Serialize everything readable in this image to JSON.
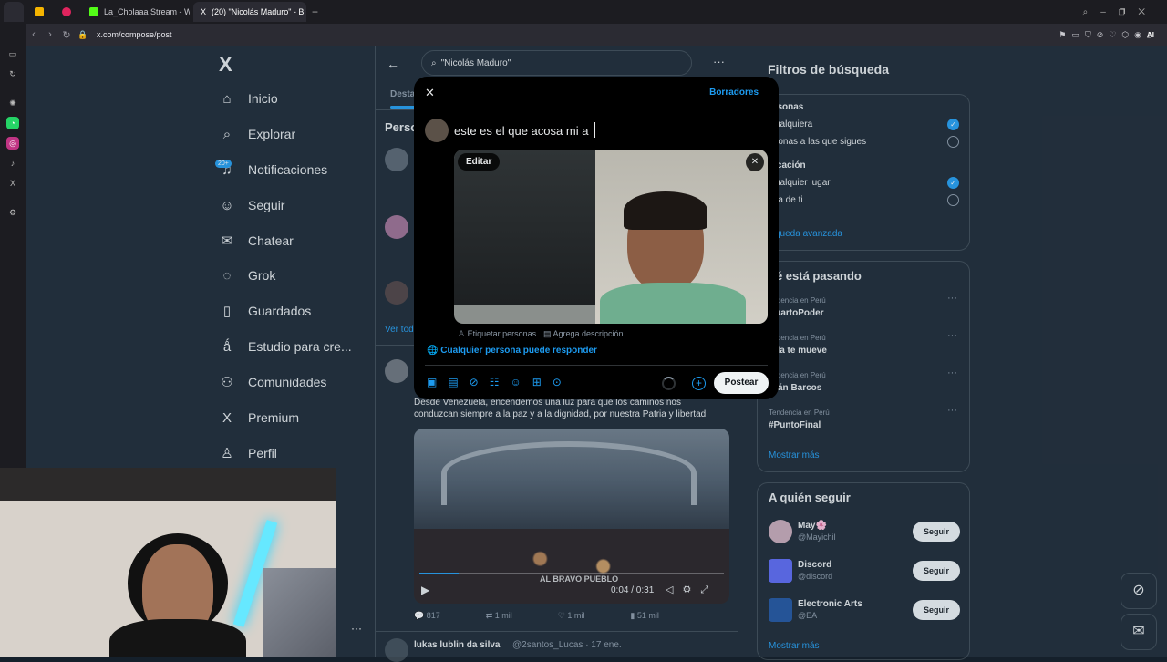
{
  "browser": {
    "tabs": [
      {
        "label": "La_Cholaaa Stream - Wat",
        "fav_color": "#53fc18"
      },
      {
        "label": "(20) \"Nicolás Maduro\" - B",
        "fav_color": "#ffffff"
      }
    ],
    "url": "x.com/compose/post",
    "ai_label": "AI"
  },
  "nav": {
    "items": [
      {
        "label": "Inicio",
        "icon": "home-icon",
        "glyph": "⌂"
      },
      {
        "label": "Explorar",
        "icon": "search-icon",
        "glyph": "⌕"
      },
      {
        "label": "Notificaciones",
        "icon": "bell-icon",
        "glyph": "♫"
      },
      {
        "label": "Seguir",
        "icon": "add-person-icon",
        "glyph": "☺"
      },
      {
        "label": "Chatear",
        "icon": "mail-icon",
        "glyph": "✉"
      },
      {
        "label": "Grok",
        "icon": "grok-icon",
        "glyph": "◌"
      },
      {
        "label": "Guardados",
        "icon": "bookmark-icon",
        "glyph": "▯"
      },
      {
        "label": "Estudio para cre...",
        "icon": "studio-icon",
        "glyph": "ǻ"
      },
      {
        "label": "Comunidades",
        "icon": "communities-icon",
        "glyph": "⚇"
      },
      {
        "label": "Premium",
        "icon": "x-icon",
        "glyph": "X"
      },
      {
        "label": "Perfil",
        "icon": "profile-icon",
        "glyph": "♙"
      }
    ],
    "notif_badge": "20+"
  },
  "center": {
    "search_value": "\"Nicolás Maduro\"",
    "tab_fragment": "Desta",
    "section_fragment": "Perso",
    "see_all_fragment": "Ver tod",
    "post_text": "Desde Venezuela, encendemos una luz para que los caminos nos conduzcan siempre a la paz y a la dignidad, por nuestra Patria y libertad.",
    "video_caption": "AL BRAVO PUEBLO",
    "video_time": "0:04 / 0:31",
    "stats": {
      "replies": "817",
      "reposts": "1 mil",
      "likes": "1 mil",
      "views": "51 mil"
    },
    "next_author": "lukas lublin da silva",
    "next_handle": "@2santos_Lucas · 17 ene."
  },
  "modal": {
    "drafts": "Borradores",
    "compose_text": "este es el que acosa mi a",
    "edit_label": "Editar",
    "tag_people": "Etiquetar personas",
    "add_description": "Agrega descripción",
    "reply_setting": "Cualquier persona puede responder",
    "post_button": "Postear"
  },
  "right": {
    "filters_title": "Filtros de búsqueda",
    "people_heading": "ersonas",
    "people_options": [
      "cualquiera",
      "rsonas a las que sigues"
    ],
    "location_heading": "bicación",
    "location_options": [
      "cualquier lugar",
      "rca de ti"
    ],
    "advanced": "squeda avanzada",
    "trending_title": "ué está pasando",
    "trends": [
      {
        "context": "endencia en Perú",
        "name": "CuartoPoder"
      },
      {
        "context": "endencia en Perú",
        "name": "oda te mueve"
      },
      {
        "context": "endencia en Perú",
        "name": "rnán Barcos"
      },
      {
        "context": "Tendencia en Perú",
        "name": "#PuntoFinal"
      }
    ],
    "show_more": "Mostrar más",
    "who_title": "A quién seguir",
    "follows": [
      {
        "name": "May🌸",
        "handle": "@Mayichil"
      },
      {
        "name": "Discord",
        "handle": "@discord"
      },
      {
        "name": "Electronic Arts",
        "handle": "@EA"
      }
    ],
    "follow_label": "Seguir",
    "show_more_2": "Mostrar más"
  },
  "colors": {
    "accent": "#1d9bf0",
    "bg": "#15202b",
    "border": "#38444d"
  }
}
